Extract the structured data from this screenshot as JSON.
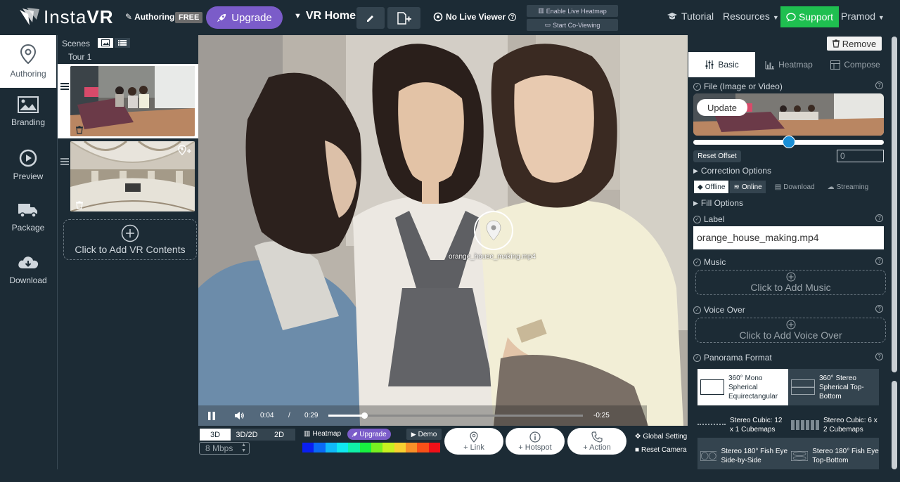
{
  "header": {
    "logo_text_light": "Insta",
    "logo_text_bold": "VR",
    "authoring_label": "Authoring",
    "plan_badge": "FREE",
    "upgrade_label": "Upgrade",
    "project_title": "VR Home",
    "live_viewer_label": "No Live Viewer",
    "enable_heatmap_label": "Enable Live Heatmap",
    "co_viewing_label": "Start Co-Viewing",
    "tutorial_label": "Tutorial",
    "resources_label": "Resources",
    "support_label": "Support",
    "user_name": "Pramod"
  },
  "leftnav": {
    "items": [
      {
        "label": "Authoring",
        "icon": "map-pin-icon",
        "active": true
      },
      {
        "label": "Branding",
        "icon": "image-icon",
        "active": false
      },
      {
        "label": "Preview",
        "icon": "play-circle-icon",
        "active": false
      },
      {
        "label": "Package",
        "icon": "truck-icon",
        "active": false
      },
      {
        "label": "Download",
        "icon": "cloud-download-icon",
        "active": false
      }
    ]
  },
  "scenes": {
    "title": "Scenes",
    "tour_label": "Tour 1",
    "add_label": "Click to Add VR Contents"
  },
  "viewport": {
    "hotspot_label": "orange_house_making.mp4",
    "current_time": "0:04",
    "separator": "/",
    "duration": "0:29",
    "remaining": "-0:25",
    "progress": 0.14
  },
  "bottombar": {
    "mode_3d": "3D",
    "mode_3d2d": "3D/2D",
    "mode_2d": "2D",
    "bitrate": "8 Mbps",
    "heatmap_label": "Heatmap",
    "upgrade_label": "Upgrade",
    "demo_label": "Demo",
    "add_link": "+ Link",
    "add_hotspot": "+ Hotspot",
    "add_action": "+ Action",
    "global_setting": "Global Setting",
    "reset_camera": "Reset Camera",
    "heat_colors": [
      "#0a1ff0",
      "#0a6af5",
      "#10b9f8",
      "#10e8f0",
      "#10f0a8",
      "#18f040",
      "#78f020",
      "#c8f020",
      "#f8d030",
      "#f89028",
      "#f85018",
      "#f01018"
    ]
  },
  "rightpanel": {
    "remove_label": "Remove",
    "tabs": [
      {
        "label": "Basic",
        "icon": "sliders-icon",
        "active": true
      },
      {
        "label": "Heatmap",
        "icon": "bar-chart-icon",
        "active": false
      },
      {
        "label": "Compose",
        "icon": "grid-icon",
        "active": false
      }
    ],
    "file_title": "File (Image or Video)",
    "update_label": "Update",
    "offset_slider": 0.5,
    "reset_offset": "Reset Offset",
    "offset_value": "0",
    "correction_title": "Correction Options",
    "offline_label": "Offline",
    "online_label": "Online",
    "download_label": "Download",
    "streaming_label": "Streaming",
    "fill_title": "Fill Options",
    "label_title": "Label",
    "label_value": "orange_house_making.mp4",
    "music_title": "Music",
    "add_music": "Click to Add Music",
    "voice_title": "Voice Over",
    "add_voice": "Click to Add Voice Over",
    "panorama_title": "Panorama Format",
    "formats": [
      {
        "label": "360° Mono Spherical Equirectangular",
        "selected": true
      },
      {
        "label": "360° Stereo Spherical Top-Bottom",
        "selected": false
      },
      {
        "label": "Stereo Cubic: 12 x 1 Cubemaps",
        "selected": false
      },
      {
        "label": "Stereo Cubic: 6 x 2 Cubemaps",
        "selected": false
      },
      {
        "label": "Stereo 180° Fish Eye Side-by-Side",
        "selected": false
      },
      {
        "label": "Stereo 180° Fish Eye Top-Bottom",
        "selected": false
      }
    ]
  }
}
